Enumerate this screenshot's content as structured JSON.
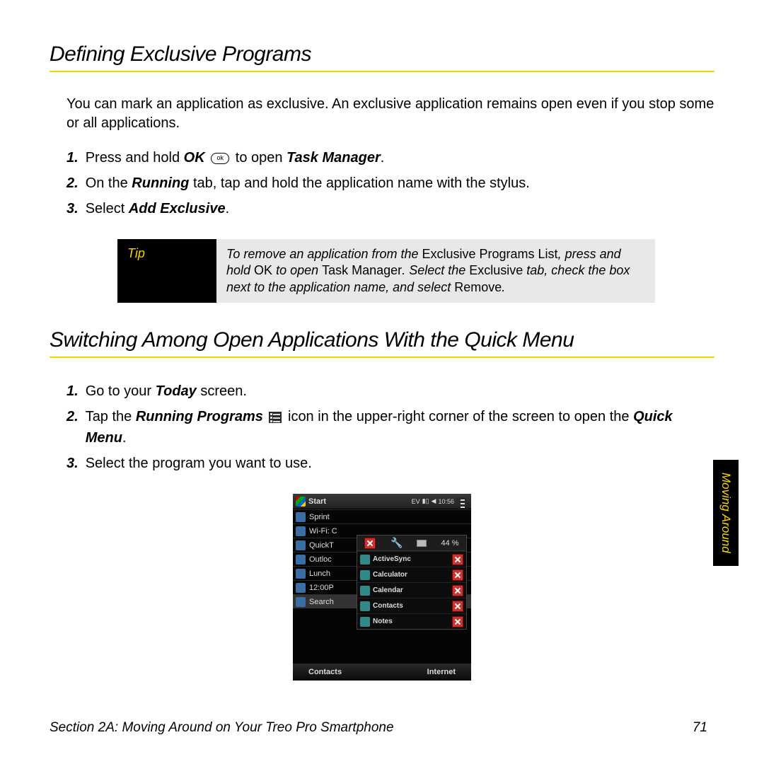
{
  "section1": {
    "title": "Defining Exclusive Programs",
    "intro": "You can mark an application as exclusive. An exclusive application remains open even if you stop some or all applications.",
    "steps": [
      {
        "pre": "Press and hold ",
        "b1": "OK",
        "mid": " ",
        "icon": "ok",
        "post": " to open ",
        "b2": "Task Manager",
        "tail": "."
      },
      {
        "pre": "On the ",
        "b1": "Running",
        "mid": " tab, tap and hold the application name with the stylus.",
        "icon": "",
        "post": "",
        "b2": "",
        "tail": ""
      },
      {
        "pre": "Select ",
        "b1": "Add Exclusive",
        "mid": ".",
        "icon": "",
        "post": "",
        "b2": "",
        "tail": ""
      }
    ]
  },
  "tip": {
    "label": "Tip",
    "t1": "To remove an application from the ",
    "r1": "Exclusive Programs List",
    "t2": ", press and hold ",
    "r2": "OK",
    "t3": " to open ",
    "r3": "Task Manager",
    "t4": ". Select the ",
    "r4": "Exclusive",
    "t5": " tab, check the box next to the application name, and select ",
    "r5": "Remove",
    "t6": "."
  },
  "section2": {
    "title": "Switching Among Open Applications With the Quick Menu",
    "steps": [
      {
        "pre": "Go to your ",
        "b1": "Today",
        "mid": " screen.",
        "icon": "",
        "post": "",
        "b2": "",
        "tail": ""
      },
      {
        "pre": "Tap the ",
        "b1": "Running Programs",
        "mid": " ",
        "icon": "run",
        "post": " icon in the upper-right corner of the screen to open the ",
        "b2": "Quick Menu",
        "tail": "."
      },
      {
        "pre": "Select the program you want to use.",
        "b1": "",
        "mid": "",
        "icon": "",
        "post": "",
        "b2": "",
        "tail": ""
      }
    ]
  },
  "phone": {
    "start": "Start",
    "time": "10:56",
    "battery_pct": "44 %",
    "left_rows": [
      "Sprint",
      "Wi-Fi: C",
      "QuickT",
      "Outloc",
      "Lunch",
      "12:00P",
      "Search"
    ],
    "menu_items": [
      "ActiveSync",
      "Calculator",
      "Calendar",
      "Contacts",
      "Notes"
    ],
    "soft_left": "Contacts",
    "soft_right": "Internet"
  },
  "side_tab": "Moving Around",
  "footer": {
    "left": "Section 2A: Moving Around on Your Treo Pro Smartphone",
    "right": "71"
  }
}
